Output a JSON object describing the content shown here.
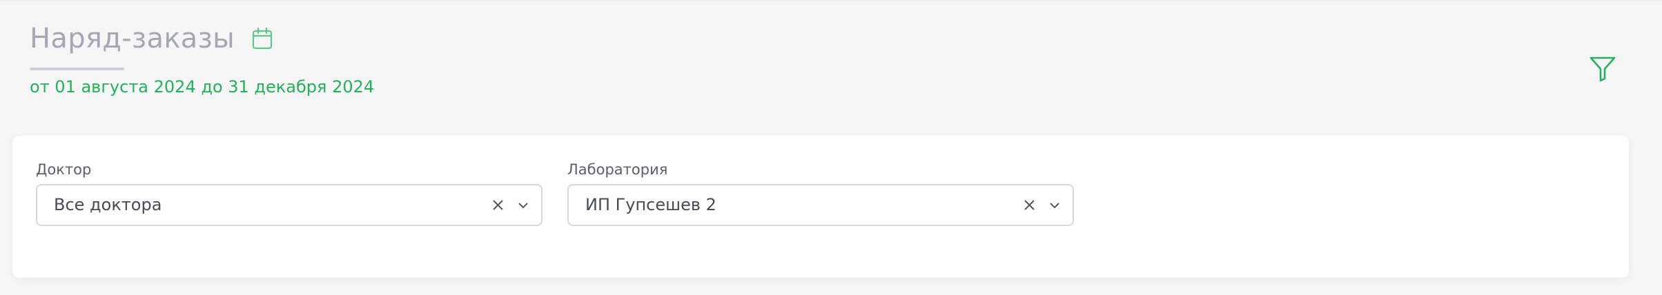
{
  "header": {
    "title": "Наряд-заказы",
    "date_range": "от 01 августа 2024 до 31 декабря 2024",
    "calendar_icon": "calendar-icon",
    "filter_icon": "filter-icon"
  },
  "filters": {
    "doctor": {
      "label": "Доктор",
      "value": "Все доктора"
    },
    "laboratory": {
      "label": "Лаборатория",
      "value": "ИП Гупсешев 2"
    }
  },
  "colors": {
    "accent": "#22b259",
    "title": "#a7a7b2",
    "background": "#f6f6f7"
  }
}
